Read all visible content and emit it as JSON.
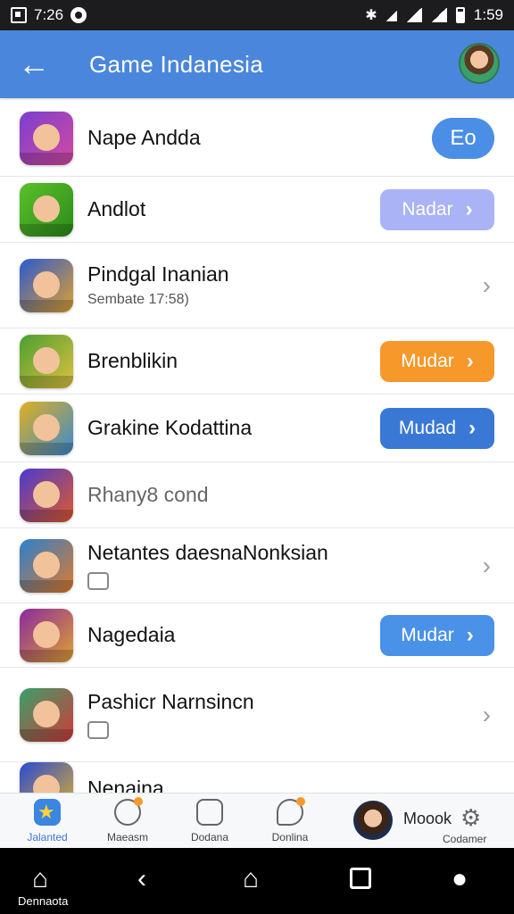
{
  "status_bar": {
    "time": "7:26",
    "battery_text": "1:59"
  },
  "app_bar": {
    "back_icon": "arrow-left-icon",
    "title": "Game Indanesia"
  },
  "list": [
    {
      "title": "Nape Andda",
      "action": {
        "label": "Eo",
        "style": "eo"
      },
      "icon_colors": [
        "#7a3fd0",
        "#d44aa0"
      ]
    },
    {
      "title": "Andlot",
      "action": {
        "label": "Nadar",
        "style": "lavender"
      },
      "icon_colors": [
        "#5cc02a",
        "#2a8a1a"
      ]
    },
    {
      "title": "Pindgal Inanian",
      "subtitle": "Sembate 17:58)",
      "chevron": true,
      "icon_colors": [
        "#2a5ad0",
        "#e0a030"
      ]
    },
    {
      "title": "Brenblikin",
      "action": {
        "label": "Mudar",
        "style": "orange"
      },
      "icon_colors": [
        "#4aa030",
        "#e0c040"
      ]
    },
    {
      "title": "Grakine Kodattina",
      "action": {
        "label": "Mudad",
        "style": "blue"
      },
      "icon_colors": [
        "#e0b020",
        "#3a8ad0"
      ]
    },
    {
      "title": "Rhany8 cond",
      "muted": true,
      "icon_colors": [
        "#4a3ad0",
        "#e05a2a"
      ]
    },
    {
      "title": "Netantes daesnaNonksian",
      "glyph": true,
      "chevron": true,
      "icon_colors": [
        "#2a80d0",
        "#e07a2a"
      ]
    },
    {
      "title": "Nagedaia",
      "action": {
        "label": "Mudar",
        "style": "lightblue"
      },
      "icon_colors": [
        "#8a2aa0",
        "#e0a030"
      ]
    },
    {
      "title": "Pashicr Narnsincn",
      "glyph": true,
      "chevron": true,
      "icon_colors": [
        "#3aa06a",
        "#d03a3a"
      ]
    },
    {
      "title": "Nenaina",
      "icon_colors": [
        "#2a4ad0",
        "#e0b030"
      ]
    }
  ],
  "bottom_nav": {
    "items": [
      {
        "label": "Jalanted",
        "icon": "star-icon",
        "active": true
      },
      {
        "label": "Maeasm",
        "icon": "profile-icon",
        "badge": true
      },
      {
        "label": "Dodana",
        "icon": "badge-icon"
      },
      {
        "label": "Donlina",
        "icon": "chat-icon",
        "badge": true
      }
    ],
    "user_name": "Moook",
    "settings_label": "Codamer"
  },
  "system_nav": {
    "home_label": "Dennaota"
  },
  "colors": {
    "app_bar": "#4a86dc",
    "accent": "#3a78d6",
    "orange": "#f6982a"
  }
}
